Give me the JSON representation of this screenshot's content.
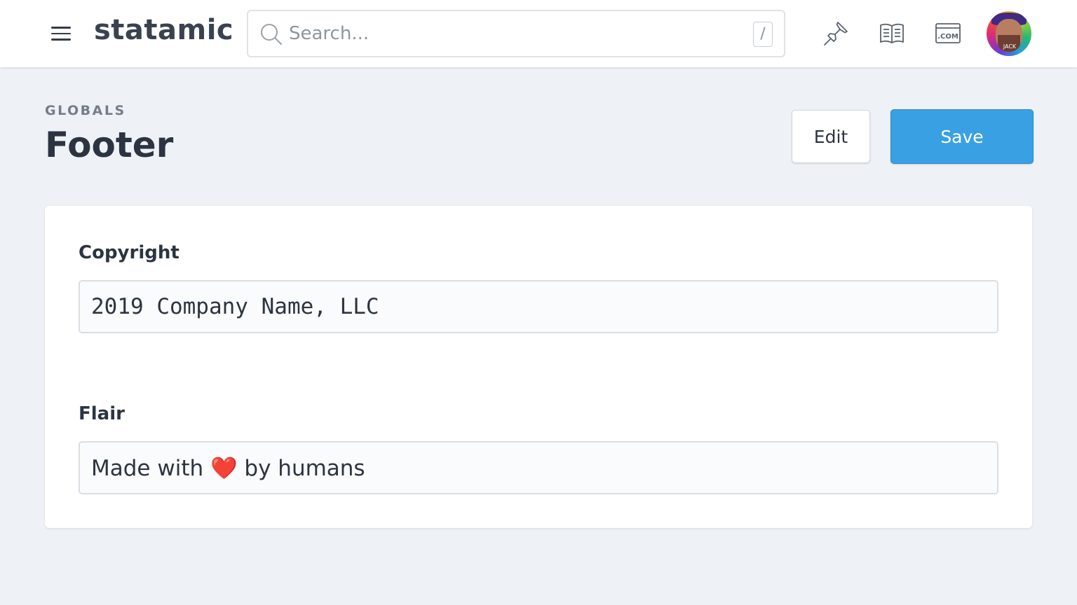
{
  "app": {
    "logo": "statamic"
  },
  "search": {
    "placeholder": "Search...",
    "value": "",
    "shortcut": "/"
  },
  "topbar_icons": [
    "pin-icon",
    "docs-book-icon",
    "dot-com-icon"
  ],
  "user": {
    "avatar_label": "JACK"
  },
  "header": {
    "breadcrumb": "GLOBALS",
    "title": "Footer",
    "edit_label": "Edit",
    "save_label": "Save"
  },
  "fields": {
    "copyright": {
      "label": "Copyright",
      "value": "2019 Company Name, LLC"
    },
    "flair": {
      "label": "Flair",
      "value": "Made with ❤️ by humans"
    }
  },
  "colors": {
    "save": "#3aa0e4",
    "background": "#eef1f6"
  }
}
